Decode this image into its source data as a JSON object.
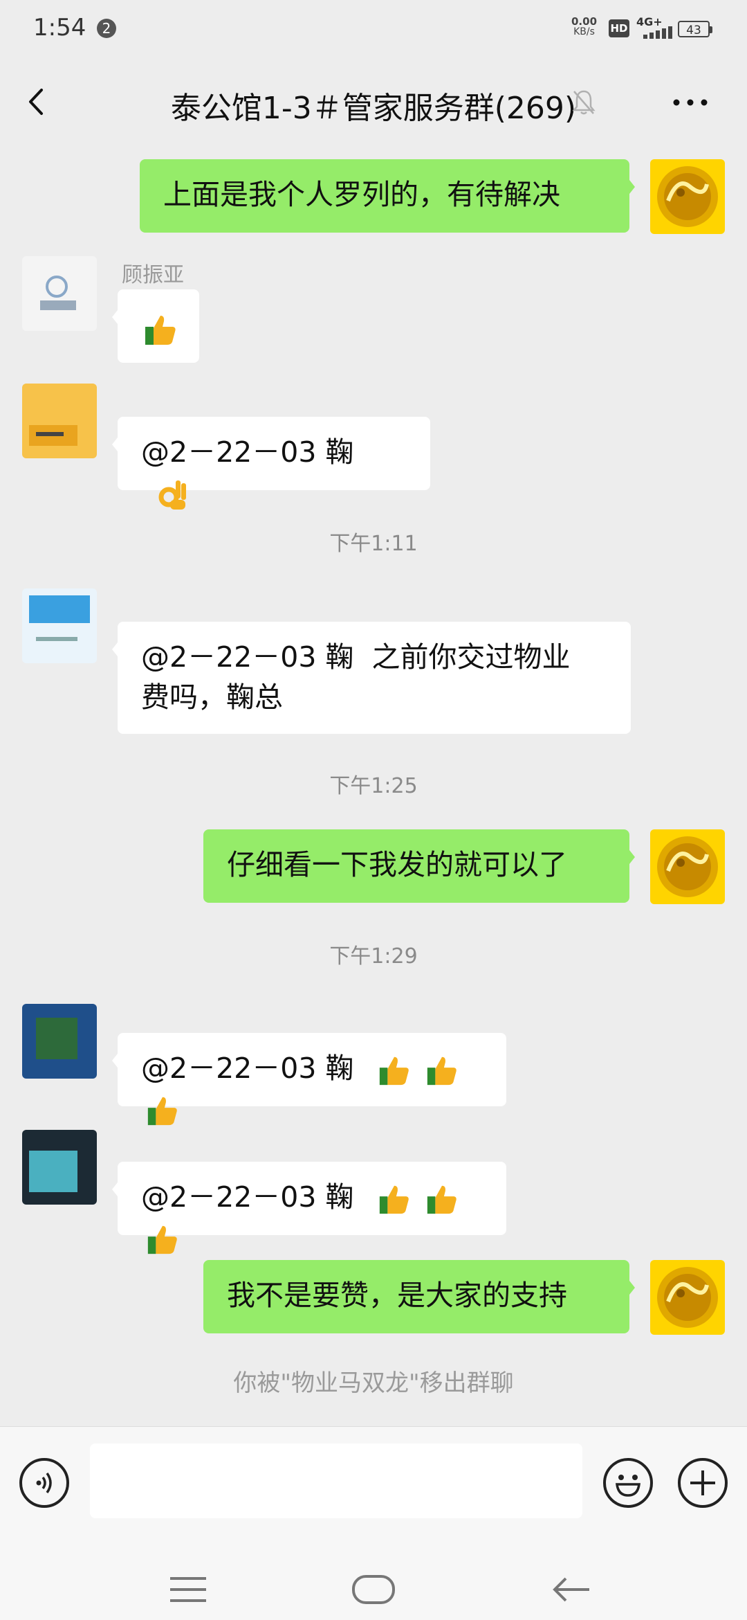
{
  "status_bar": {
    "time": "1:54",
    "notification_count": "2",
    "speed_value": "0.00",
    "speed_unit": "KB/s",
    "hd": "HD",
    "network": "4G+",
    "battery": "43"
  },
  "header": {
    "title": "泰公馆1-3＃管家服务群(269)",
    "back_icon": "chevron-left-icon",
    "mute_icon": "bell-muted-icon",
    "more_icon": "more-horizontal-icon"
  },
  "messages": [
    {
      "direction": "out",
      "text": "上面是我个人罗列的，有待解决"
    },
    {
      "direction": "in",
      "sender": "顾振亚",
      "text": "",
      "emoji": "thumbs-up"
    },
    {
      "direction": "in",
      "sender": "",
      "text": "@2－22－03 鞠",
      "emoji": "ok-hand"
    },
    {
      "type": "time",
      "text": "下午1:11"
    },
    {
      "direction": "in",
      "sender": "",
      "text_line1": "@2－22－03 鞠  之前你交过物业",
      "text_line2": "费吗，鞠总"
    },
    {
      "type": "time",
      "text": "下午1:25"
    },
    {
      "direction": "out",
      "text": "仔细看一下我发的就可以了"
    },
    {
      "type": "time",
      "text": "下午1:29"
    },
    {
      "direction": "in",
      "sender": "",
      "text": "@2－22－03 鞠",
      "emoji": "three-thumbs-up"
    },
    {
      "direction": "in",
      "sender": "",
      "text": "@2－22－03 鞠",
      "emoji": "three-thumbs-up"
    },
    {
      "direction": "out",
      "text": "我不是要赞，是大家的支持"
    },
    {
      "type": "system",
      "text": "你被\"物业马双龙\"移出群聊"
    }
  ],
  "input_bar": {
    "voice_icon": "voice-input-icon",
    "text_value": "",
    "emoji_icon": "smiley-icon",
    "plus_icon": "plus-circle-icon"
  },
  "system_nav": {
    "menu_icon": "menu-icon",
    "home_icon": "home-icon",
    "back_icon": "back-arrow-icon"
  },
  "colors": {
    "background": "#ededed",
    "outgoing_bubble": "#95ec69",
    "incoming_bubble": "#ffffff",
    "muted_text": "#8a8a8a"
  }
}
